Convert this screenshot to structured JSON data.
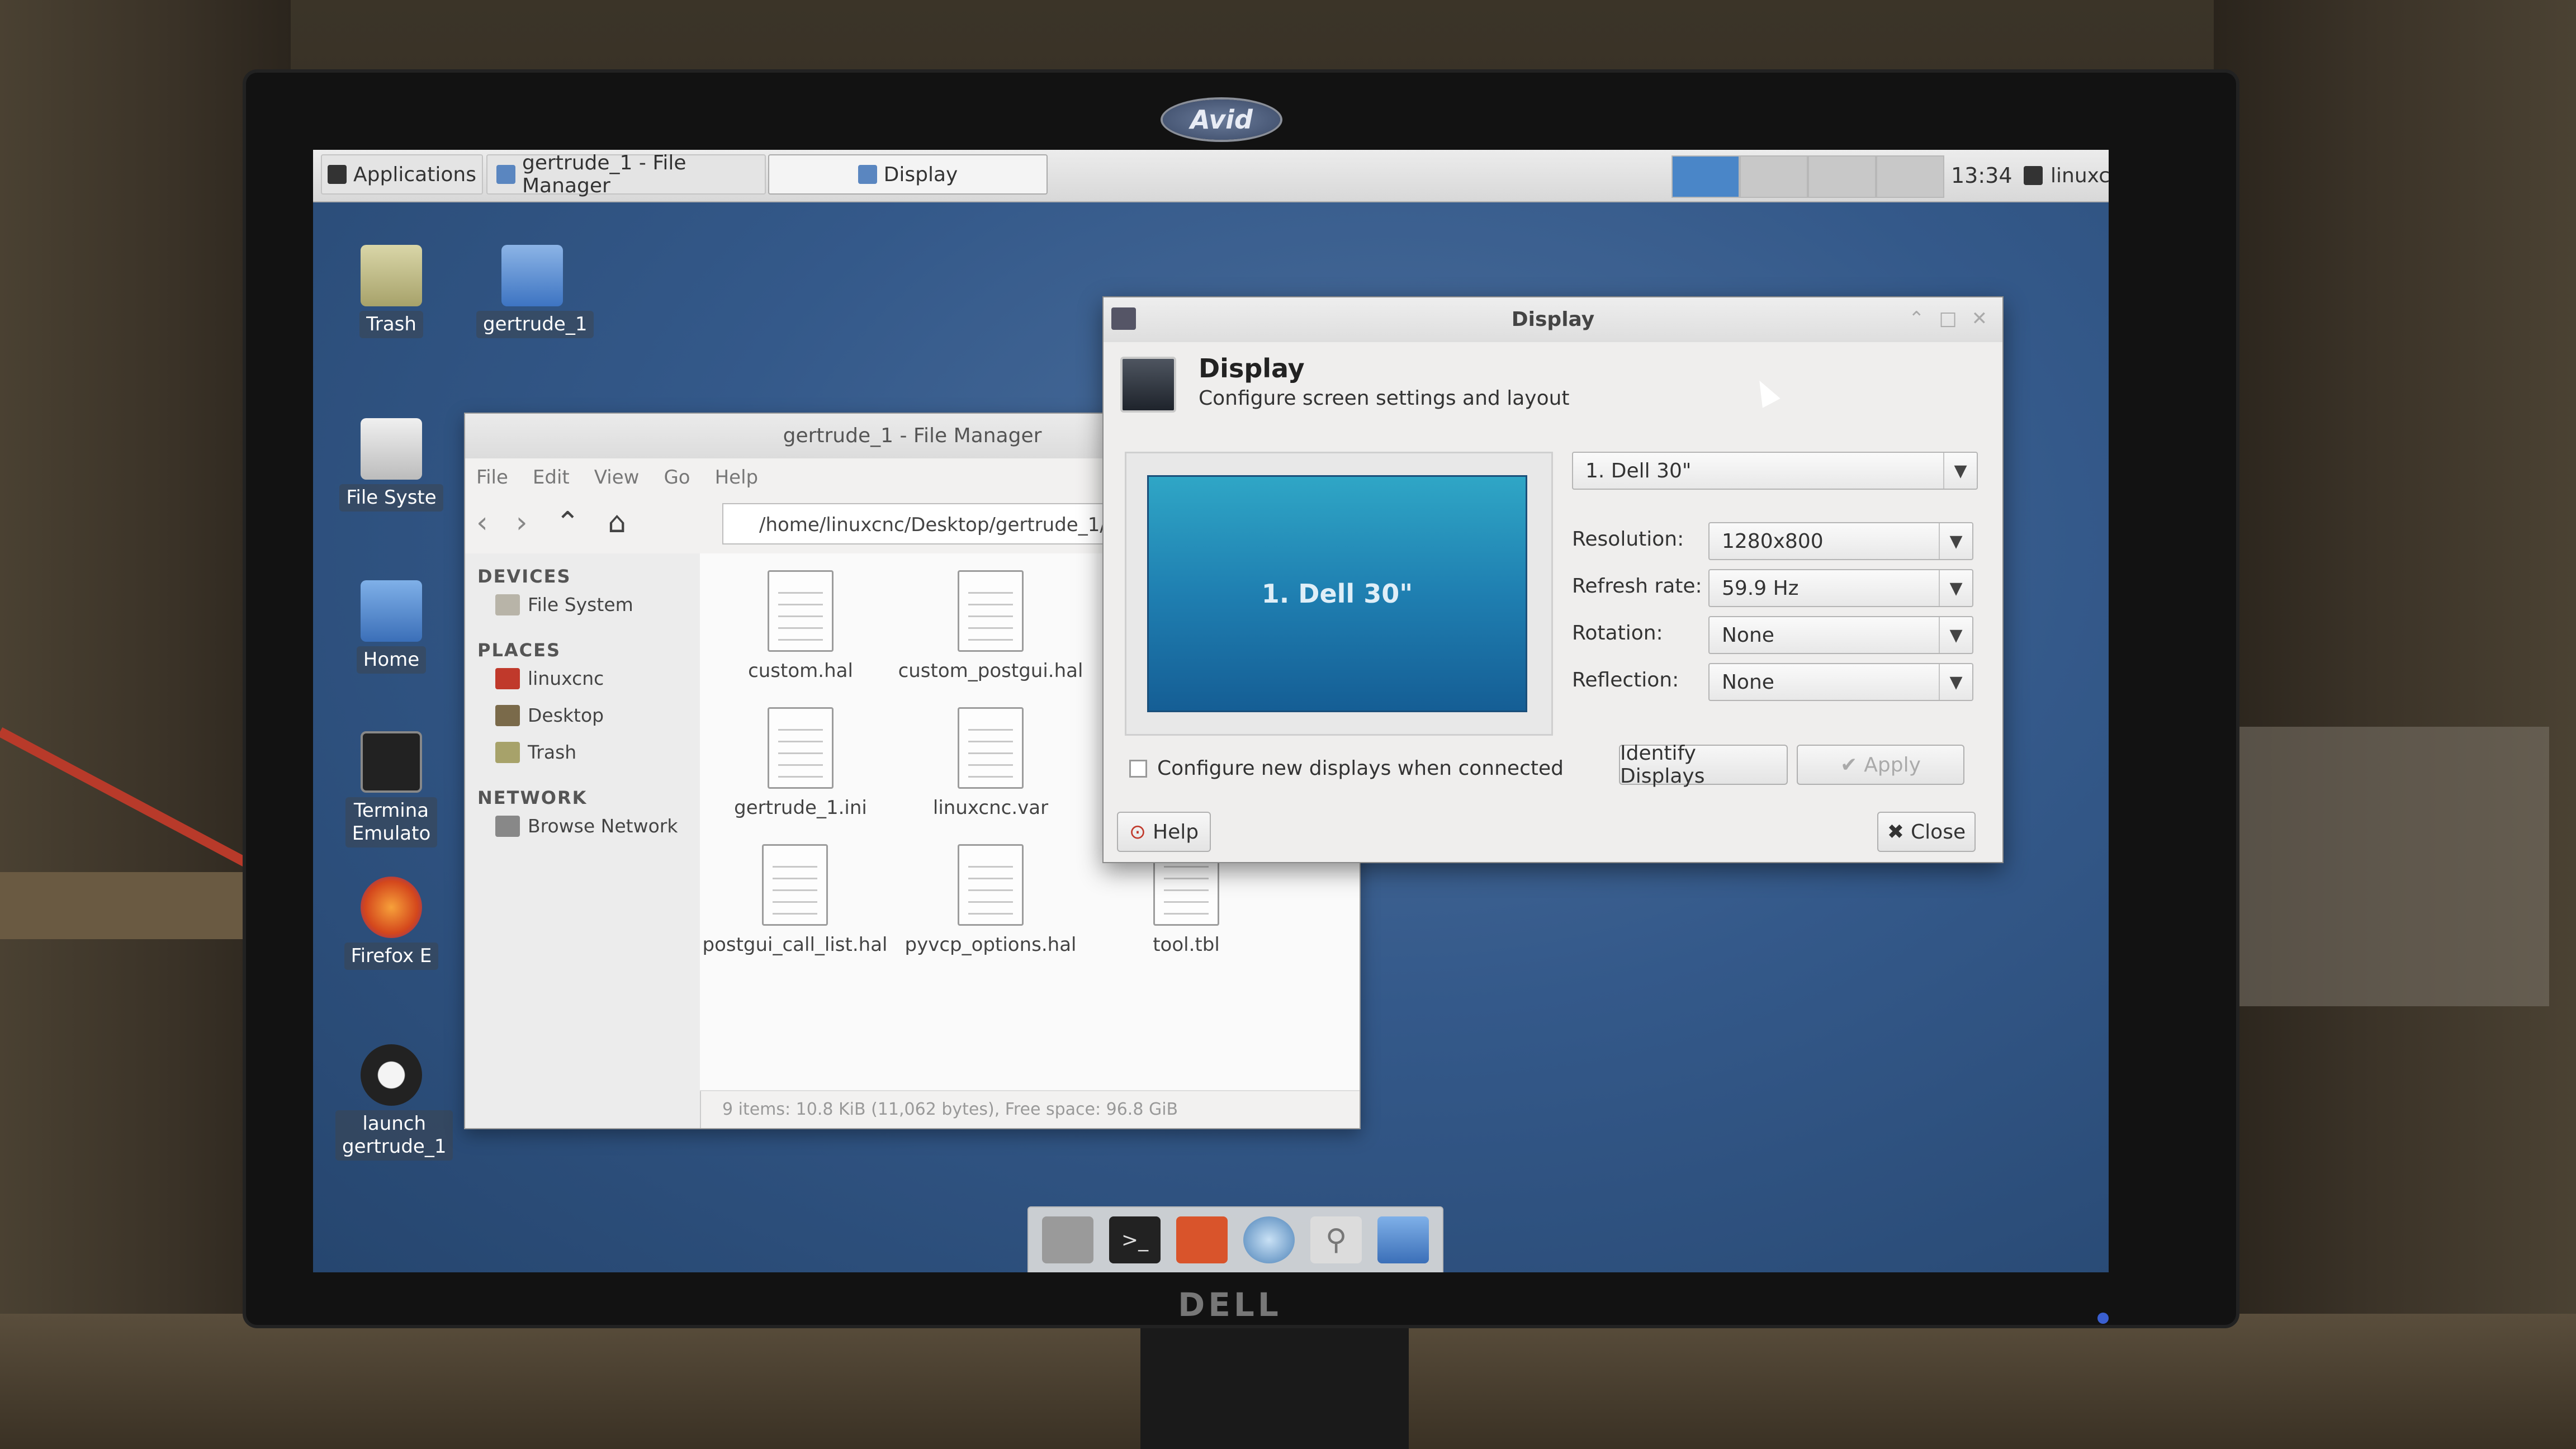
{
  "monitor": {
    "brand_top": "Avid",
    "brand_bottom": "DELL"
  },
  "panel": {
    "applications_label": "Applications",
    "tasks": [
      "gertrude_1 - File Manager",
      "Display"
    ],
    "clock": "13:34",
    "user": "linuxcnc"
  },
  "desktop_icons": {
    "trash": "Trash",
    "gertrude": "gertrude_1",
    "filesystem": "File Syste",
    "home": "Home",
    "terminal": "Termina\nEmulato",
    "firefox": "Firefox E",
    "launch": "launch\ngertrude_1"
  },
  "file_manager": {
    "title": "gertrude_1 - File Manager",
    "menu": [
      "File",
      "Edit",
      "View",
      "Go",
      "Help"
    ],
    "path": "/home/linuxcnc/Desktop/gertrude_1/",
    "sections": {
      "devices": "DEVICES",
      "places": "PLACES",
      "network": "NETWORK"
    },
    "devices": [
      "File System"
    ],
    "places": [
      "linuxcnc",
      "Desktop",
      "Trash"
    ],
    "network": [
      "Browse Network"
    ],
    "files": [
      "custom.hal",
      "custom_postgui.hal",
      "gertrude_1.ini",
      "linuxcnc.var",
      "postgui_call_list.hal",
      "pyvcp_options.hal",
      "tool.tbl"
    ],
    "status": "9 items: 10.8 KiB (11,062 bytes), Free space: 96.8 GiB"
  },
  "display_dialog": {
    "title": "Display",
    "heading": "Display",
    "subheading": "Configure screen settings and layout",
    "preview_label": "1. Dell 30\"",
    "output_select": "1. Dell 30\"",
    "resolution_label": "Resolution:",
    "resolution_value": "1280x800",
    "refresh_label": "Refresh rate:",
    "refresh_value": "59.9 Hz",
    "rotation_label": "Rotation:",
    "rotation_value": "None",
    "reflection_label": "Reflection:",
    "reflection_value": "None",
    "configure_new_label": "Configure new displays when connected",
    "configure_new_checked": false,
    "identify_button": "Identify Displays",
    "apply_button": "Apply",
    "help_button": "Help",
    "close_button": "Close"
  }
}
